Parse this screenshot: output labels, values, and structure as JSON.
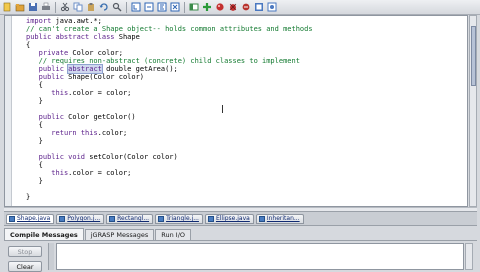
{
  "toolbar": {
    "buttons": [
      {
        "icon": "new-file-icon",
        "color": "#f2c94c"
      },
      {
        "icon": "open-folder-icon",
        "color": "#e0a33a"
      },
      {
        "icon": "save-icon",
        "color": "#4a6fb3"
      },
      {
        "icon": "print-icon",
        "color": "#7a7f88"
      },
      {
        "icon": "cut-icon",
        "color": "#555b63"
      },
      {
        "icon": "copy-icon",
        "color": "#6c8fc7"
      },
      {
        "icon": "paste-icon",
        "color": "#c9a35a"
      },
      {
        "icon": "undo-icon",
        "color": "#3a6fb0"
      },
      {
        "icon": "find-icon",
        "color": "#555b63"
      },
      {
        "icon": "generate-csd-icon",
        "color": "#2f66b4"
      },
      {
        "icon": "remove-csd-icon",
        "color": "#2f66b4"
      },
      {
        "icon": "fold-icon",
        "color": "#2f66b4"
      },
      {
        "icon": "unfold-icon",
        "color": "#2f66b4"
      },
      {
        "icon": "browse-icon",
        "color": "#3a8a4a"
      },
      {
        "icon": "compile-icon",
        "color": "#2a9a3a"
      },
      {
        "icon": "run-icon",
        "color": "#c33030"
      },
      {
        "icon": "debug-icon",
        "color": "#c33030"
      },
      {
        "icon": "step-icon",
        "color": "#b8332e"
      },
      {
        "icon": "interactions-icon",
        "color": "#4a78c0"
      },
      {
        "icon": "viewer-icon",
        "color": "#4a78c0"
      }
    ]
  },
  "editor": {
    "lines": [
      [
        {
          "t": "import",
          "c": "kw"
        },
        {
          "t": " java.awt.*;",
          "c": ""
        }
      ],
      [
        {
          "t": "// can't create a Shape object-- holds common attributes and methods",
          "c": "cm"
        }
      ],
      [
        {
          "t": "public abstract class",
          "c": "kw"
        },
        {
          "t": " Shape",
          "c": ""
        }
      ],
      [
        {
          "t": "{",
          "c": ""
        }
      ],
      [
        {
          "t": "   ",
          "c": ""
        },
        {
          "t": "private",
          "c": "kw"
        },
        {
          "t": " Color color;",
          "c": ""
        }
      ],
      [
        {
          "t": "   // requires non-abstract (concrete) child classes to implement",
          "c": "cm"
        }
      ],
      [
        {
          "t": "   ",
          "c": ""
        },
        {
          "t": "public",
          "c": "kw"
        },
        {
          "t": " ",
          "c": ""
        },
        {
          "t": "abstract",
          "c": "kw hl"
        },
        {
          "t": " double getArea();",
          "c": ""
        }
      ],
      [
        {
          "t": "   ",
          "c": ""
        },
        {
          "t": "public",
          "c": "kw"
        },
        {
          "t": " Shape(Color color)",
          "c": ""
        }
      ],
      [
        {
          "t": "   {",
          "c": ""
        }
      ],
      [
        {
          "t": "      ",
          "c": ""
        },
        {
          "t": "this",
          "c": "kw"
        },
        {
          "t": ".color = color;",
          "c": ""
        }
      ],
      [
        {
          "t": "   }",
          "c": ""
        }
      ],
      [
        {
          "t": "",
          "c": ""
        }
      ],
      [
        {
          "t": "   ",
          "c": ""
        },
        {
          "t": "public",
          "c": "kw"
        },
        {
          "t": " Color getColor()",
          "c": ""
        }
      ],
      [
        {
          "t": "   {",
          "c": ""
        }
      ],
      [
        {
          "t": "      ",
          "c": ""
        },
        {
          "t": "return",
          "c": "kw"
        },
        {
          "t": " ",
          "c": ""
        },
        {
          "t": "this",
          "c": "kw"
        },
        {
          "t": ".color;",
          "c": ""
        }
      ],
      [
        {
          "t": "   }",
          "c": ""
        }
      ],
      [
        {
          "t": "",
          "c": ""
        }
      ],
      [
        {
          "t": "   ",
          "c": ""
        },
        {
          "t": "public void",
          "c": "kw"
        },
        {
          "t": " setColor(Color color)",
          "c": ""
        }
      ],
      [
        {
          "t": "   {",
          "c": ""
        }
      ],
      [
        {
          "t": "      ",
          "c": ""
        },
        {
          "t": "this",
          "c": "kw"
        },
        {
          "t": ".color = color;",
          "c": ""
        }
      ],
      [
        {
          "t": "   }",
          "c": ""
        }
      ],
      [
        {
          "t": "",
          "c": ""
        }
      ],
      [
        {
          "t": "}",
          "c": ""
        }
      ]
    ]
  },
  "file_tabs": [
    {
      "label": "Shape.java",
      "active": true
    },
    {
      "label": "Polygon.j...",
      "active": false
    },
    {
      "label": "Rectangl...",
      "active": false
    },
    {
      "label": "Triangle.j...",
      "active": false
    },
    {
      "label": "Ellipse.java",
      "active": false
    },
    {
      "label": "Inheritan...",
      "active": false
    }
  ],
  "bottom_tabs": [
    {
      "label": "Compile Messages",
      "active": true
    },
    {
      "label": "jGRASP Messages",
      "active": false
    },
    {
      "label": "Run I/O",
      "active": false
    }
  ],
  "message_panel": {
    "stop_label": "Stop",
    "clear_label": "Clear"
  }
}
